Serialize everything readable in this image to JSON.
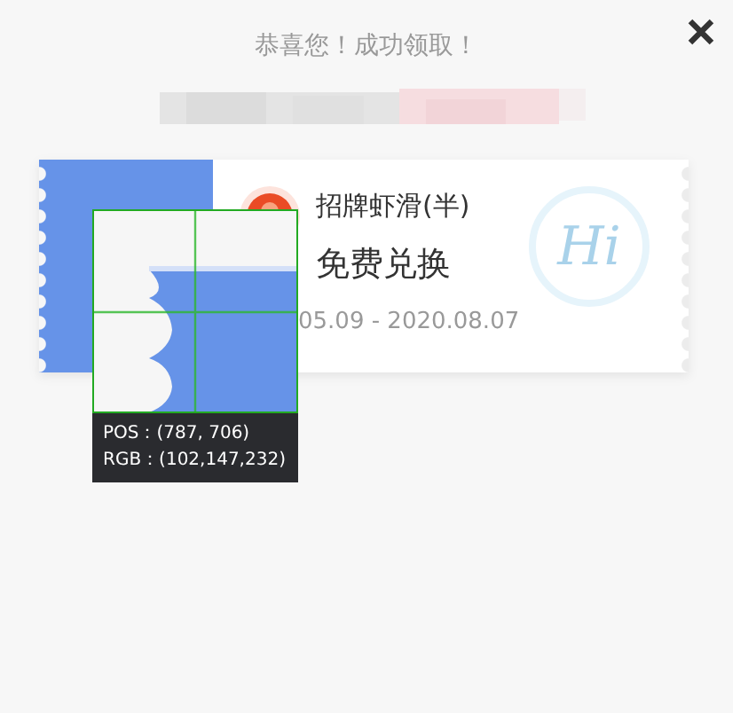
{
  "dialog": {
    "title": "恭喜您！成功领取！"
  },
  "coupon": {
    "name": "招牌虾滑(半)",
    "benefit": "免费兑换",
    "validity": "05.09 - 2020.08.07",
    "logo_text": "Hi"
  },
  "color_picker": {
    "position": "POS：(787, 706)",
    "rgb": "RGB：(102,147,232)"
  }
}
